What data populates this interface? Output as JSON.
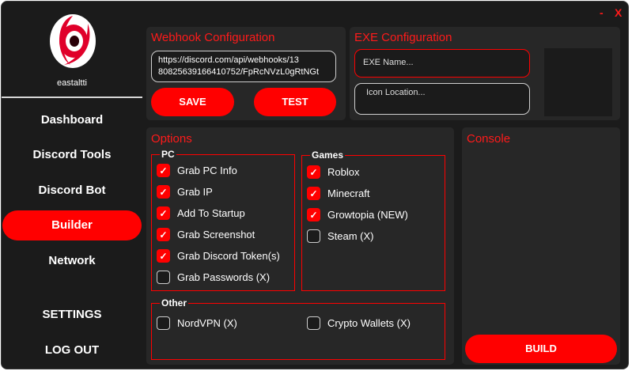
{
  "window": {
    "minimize_label": "-",
    "close_label": "X"
  },
  "sidebar": {
    "username": "eastaltti",
    "items": [
      {
        "label": "Dashboard",
        "active": false
      },
      {
        "label": "Discord Tools",
        "active": false
      },
      {
        "label": "Discord Bot",
        "active": false
      },
      {
        "label": "Builder",
        "active": true
      },
      {
        "label": "Network",
        "active": false
      },
      {
        "label": "SETTINGS",
        "active": false
      },
      {
        "label": "LOG OUT",
        "active": false
      }
    ]
  },
  "webhook": {
    "title": "Webhook Configuration",
    "url_line1": "https://discord.com/api/webhooks/13",
    "url_line2": "80825639166410752/FpRcNVzL0gRtNGt",
    "save_label": "SAVE",
    "test_label": "TEST"
  },
  "exe": {
    "title": "EXE Configuration",
    "name_placeholder": "EXE Name...",
    "icon_placeholder": "Icon Location..."
  },
  "options": {
    "title": "Options",
    "pc": {
      "label": "PC",
      "items": [
        {
          "label": "Grab PC Info",
          "checked": true
        },
        {
          "label": "Grab IP",
          "checked": true
        },
        {
          "label": "Add To Startup",
          "checked": true
        },
        {
          "label": "Grab Screenshot",
          "checked": true
        },
        {
          "label": "Grab Discord Token(s)",
          "checked": true
        },
        {
          "label": "Grab Passwords (X)",
          "checked": false
        }
      ]
    },
    "games": {
      "label": "Games",
      "items": [
        {
          "label": "Roblox",
          "checked": true
        },
        {
          "label": "Minecraft",
          "checked": true
        },
        {
          "label": "Growtopia (NEW)",
          "checked": true
        },
        {
          "label": "Steam (X)",
          "checked": false
        }
      ]
    },
    "other": {
      "label": "Other",
      "items": [
        {
          "label": "NordVPN (X)",
          "checked": false
        },
        {
          "label": "Crypto Wallets (X)",
          "checked": false
        }
      ]
    }
  },
  "console": {
    "title": "Console",
    "build_label": "BUILD"
  },
  "colors": {
    "accent": "#ff0000",
    "background": "#1b1b1b",
    "panel": "#272727"
  }
}
